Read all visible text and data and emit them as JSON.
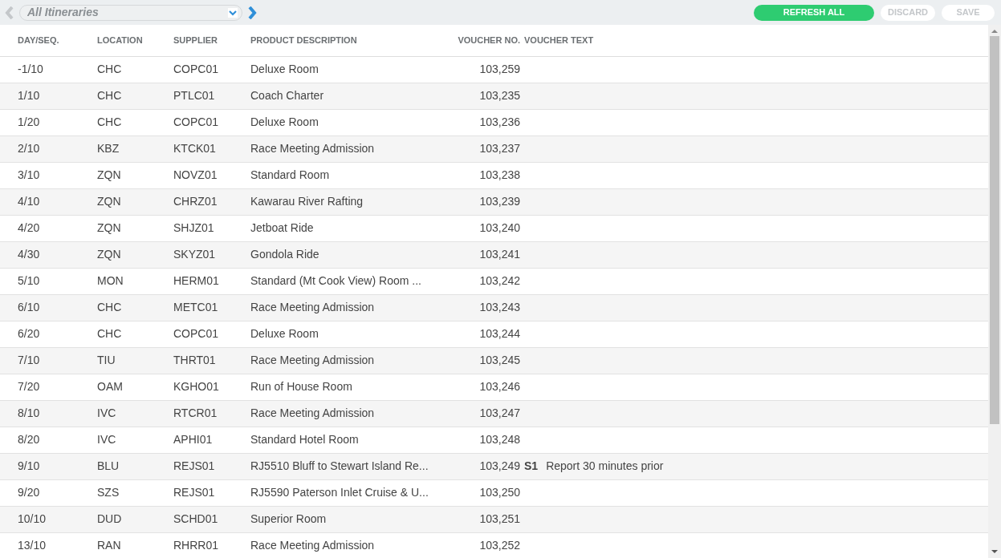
{
  "toolbar": {
    "prev_enabled": false,
    "next_enabled": true,
    "itinerary_select": {
      "value": "All Itineraries"
    },
    "buttons": [
      {
        "label": "REFRESH ALL",
        "kind": "primary",
        "disabled": false
      },
      {
        "label": "DISCARD",
        "kind": "plain",
        "disabled": true
      },
      {
        "label": "SAVE",
        "kind": "plain",
        "disabled": true
      }
    ]
  },
  "table": {
    "columns": [
      "DAY/SEQ.",
      "LOCATION",
      "SUPPLIER",
      "PRODUCT DESCRIPTION",
      "VOUCHER NO.",
      "VOUCHER TEXT"
    ],
    "rows": [
      {
        "day_seq": "-1/10",
        "location": "CHC",
        "supplier": "COPC01",
        "product": "Deluxe Room",
        "voucher_no": "103,259"
      },
      {
        "day_seq": "1/10",
        "location": "CHC",
        "supplier": "PTLC01",
        "product": "Coach Charter",
        "voucher_no": "103,235"
      },
      {
        "day_seq": "1/20",
        "location": "CHC",
        "supplier": "COPC01",
        "product": "Deluxe Room",
        "voucher_no": "103,236"
      },
      {
        "day_seq": "2/10",
        "location": "KBZ",
        "supplier": "KTCK01",
        "product": "Race Meeting Admission",
        "voucher_no": "103,237"
      },
      {
        "day_seq": "3/10",
        "location": "ZQN",
        "supplier": "NOVZ01",
        "product": "Standard Room",
        "voucher_no": "103,238"
      },
      {
        "day_seq": "4/10",
        "location": "ZQN",
        "supplier": "CHRZ01",
        "product": "Kawarau River Rafting",
        "voucher_no": "103,239"
      },
      {
        "day_seq": "4/20",
        "location": "ZQN",
        "supplier": "SHJZ01",
        "product": "Jetboat Ride",
        "voucher_no": "103,240"
      },
      {
        "day_seq": "4/30",
        "location": "ZQN",
        "supplier": "SKYZ01",
        "product": "Gondola Ride",
        "voucher_no": "103,241"
      },
      {
        "day_seq": "5/10",
        "location": "MON",
        "supplier": "HERM01",
        "product": "Standard (Mt Cook View) Room ...",
        "voucher_no": "103,242"
      },
      {
        "day_seq": "6/10",
        "location": "CHC",
        "supplier": "METC01",
        "product": "Race Meeting Admission",
        "voucher_no": "103,243"
      },
      {
        "day_seq": "6/20",
        "location": "CHC",
        "supplier": "COPC01",
        "product": "Deluxe Room",
        "voucher_no": "103,244"
      },
      {
        "day_seq": "7/10",
        "location": "TIU",
        "supplier": "THRT01",
        "product": "Race Meeting Admission",
        "voucher_no": "103,245"
      },
      {
        "day_seq": "7/20",
        "location": "OAM",
        "supplier": "KGHO01",
        "product": "Run of House Room",
        "voucher_no": "103,246"
      },
      {
        "day_seq": "8/10",
        "location": "IVC",
        "supplier": "RTCR01",
        "product": "Race Meeting Admission",
        "voucher_no": "103,247"
      },
      {
        "day_seq": "8/20",
        "location": "IVC",
        "supplier": "APHI01",
        "product": "Standard Hotel Room",
        "voucher_no": "103,248"
      },
      {
        "day_seq": "9/10",
        "location": "BLU",
        "supplier": "REJS01",
        "product": "RJ5510 Bluff to Stewart Island Re...",
        "voucher_no": "103,249",
        "voucher_code": "S1",
        "voucher_text": "Report 30 minutes prior"
      },
      {
        "day_seq": "9/20",
        "location": "SZS",
        "supplier": "REJS01",
        "product": "RJ5590 Paterson Inlet Cruise & U...",
        "voucher_no": "103,250"
      },
      {
        "day_seq": "10/10",
        "location": "DUD",
        "supplier": "SCHD01",
        "product": "Superior Room",
        "voucher_no": "103,251"
      },
      {
        "day_seq": "13/10",
        "location": "RAN",
        "supplier": "RHRR01",
        "product": "Race Meeting Admission",
        "voucher_no": "103,252"
      }
    ]
  }
}
